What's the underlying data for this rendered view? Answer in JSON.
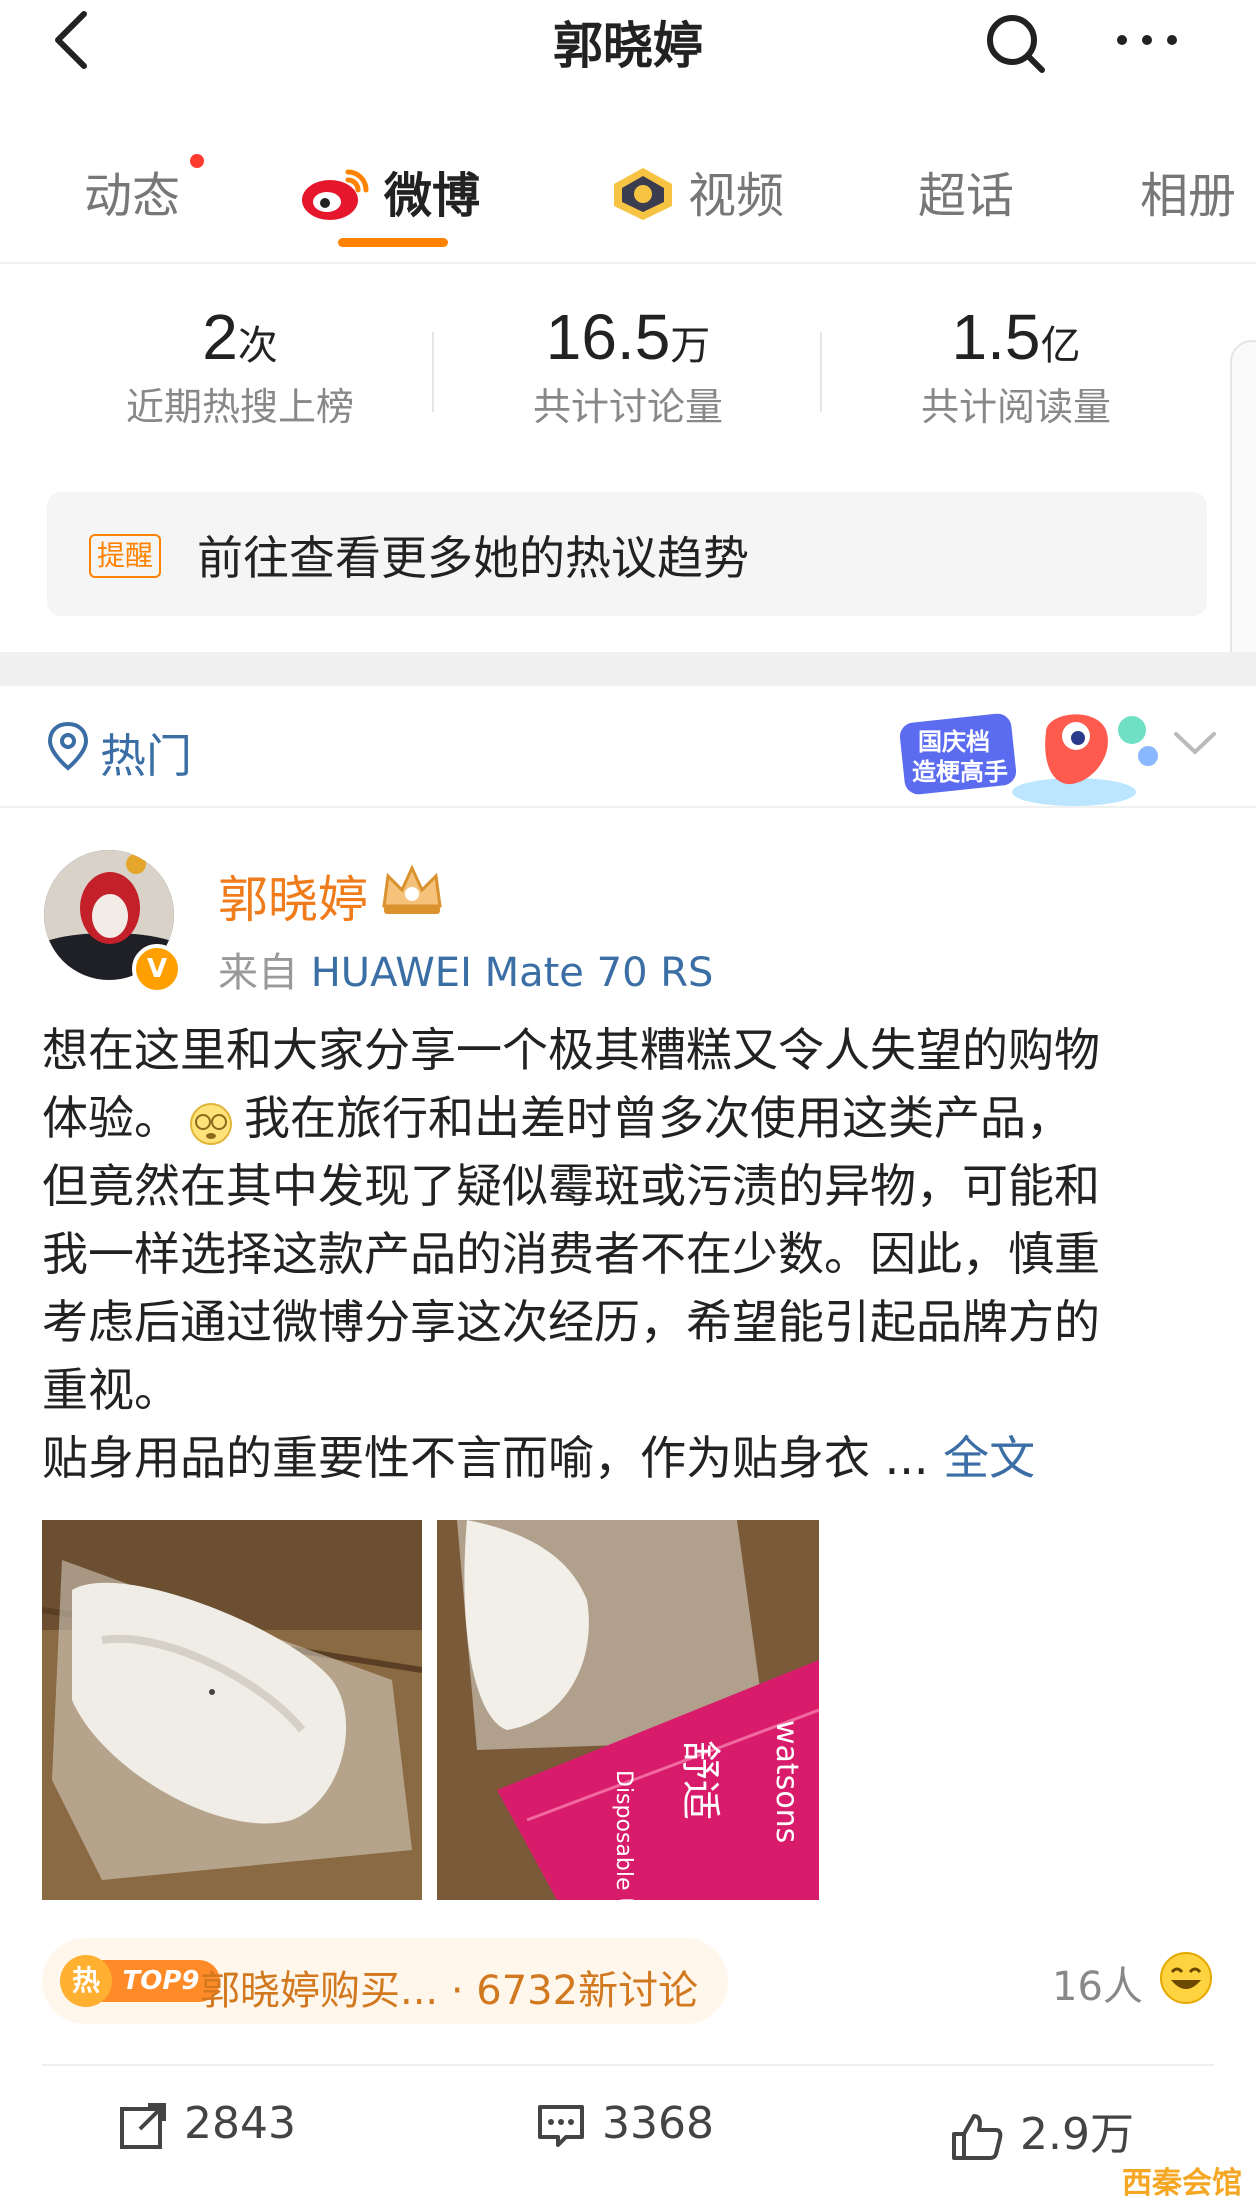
{
  "header": {
    "title": "郭晓婷"
  },
  "tabs": [
    {
      "label": "动态"
    },
    {
      "label": "微博"
    },
    {
      "label": "视频"
    },
    {
      "label": "超话"
    },
    {
      "label": "相册"
    }
  ],
  "stats": [
    {
      "num": "2",
      "unit": "次",
      "label": "近期热搜上榜"
    },
    {
      "num": "16.5",
      "unit": "万",
      "label": "共计讨论量"
    },
    {
      "num": "1.5",
      "unit": "亿",
      "label": "共计阅读量"
    }
  ],
  "reminder": {
    "tag": "提醒",
    "text": "前往查看更多她的热议趋势"
  },
  "hot_section": {
    "label": "热门",
    "badge_line1": "国庆档",
    "badge_line2": "造梗高手"
  },
  "post": {
    "user": "郭晓婷",
    "source_prefix": "来自",
    "device": "HUAWEI Mate 70 RS",
    "lines": [
      "想在这里和大家分享一个极其糟糕又令人失望的购物",
      "我在旅行和出差时曾多次使用这类产品，",
      "但竟然在其中发现了疑似霉斑或污渍的异物，可能和",
      "我一样选择这款产品的消费者不在少数。因此，慎重",
      "考虑后通过微博分享这次经历，希望能引起品牌方的",
      "重视。",
      "贴身用品的重要性不言而喻，作为贴身衣 ..."
    ],
    "line2_prefix": "体验。",
    "full_text_label": "全文",
    "topic": {
      "hot": "热",
      "rank": "TOP9",
      "text": "郭晓婷购买... · 6732新讨论"
    },
    "likes_people": "16人",
    "actions": {
      "repost": "2843",
      "comment": "3368",
      "like": "2.9万"
    }
  },
  "image2_text": {
    "brand": "watsons",
    "cn": "舒适",
    "line": "Disposable Underwear For Ladies"
  },
  "watermark": "西秦会馆"
}
